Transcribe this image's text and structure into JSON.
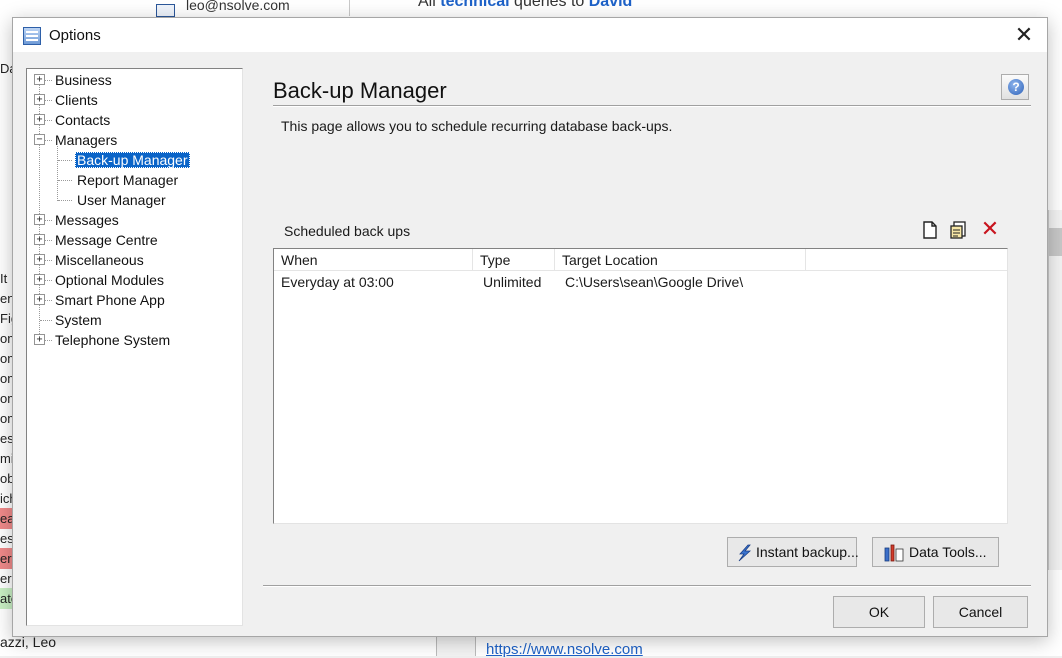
{
  "background": {
    "email": "leo@nsolve.com",
    "top_text_pre": "All ",
    "top_text_highlight1": "technical",
    "top_text_mid": " queries to ",
    "top_text_highlight2": "David",
    "left_fragments": [
      "Da",
      "It",
      "en",
      "Fig",
      "om",
      "om",
      "om",
      "om",
      "om",
      "est",
      "mit",
      "ob",
      "ich",
      "ea",
      "es",
      "erk",
      "erk",
      "ate"
    ],
    "bottom_name": "azzi, Leo",
    "url": "https://www.nsolve.com"
  },
  "dialog": {
    "title": "Options",
    "close_label": "✕"
  },
  "tree": {
    "items": [
      {
        "label": "Business",
        "level": 0,
        "expander": "+"
      },
      {
        "label": "Clients",
        "level": 0,
        "expander": "+"
      },
      {
        "label": "Contacts",
        "level": 0,
        "expander": "+"
      },
      {
        "label": "Managers",
        "level": 0,
        "expander": "−"
      },
      {
        "label": "Back-up Manager",
        "level": 1,
        "selected": true
      },
      {
        "label": "Report Manager",
        "level": 1
      },
      {
        "label": "User Manager",
        "level": 1
      },
      {
        "label": "Messages",
        "level": 0,
        "expander": "+"
      },
      {
        "label": "Message Centre",
        "level": 0,
        "expander": "+"
      },
      {
        "label": "Miscellaneous",
        "level": 0,
        "expander": "+"
      },
      {
        "label": "Optional Modules",
        "level": 0,
        "expander": "+"
      },
      {
        "label": "Smart Phone App",
        "level": 0,
        "expander": "+"
      },
      {
        "label": "System",
        "level": 0
      },
      {
        "label": "Telephone System",
        "level": 0,
        "expander": "+"
      }
    ]
  },
  "page": {
    "title": "Back-up Manager",
    "help_label": "?",
    "description": "This page allows you to schedule recurring database back-ups.",
    "scheduled_label": "Scheduled back ups",
    "delete_label": "✕"
  },
  "table": {
    "columns": [
      "When",
      "Type",
      "Target Location",
      ""
    ],
    "rows": [
      [
        "Everyday at 03:00",
        "Unlimited",
        "C:\\Users\\sean\\Google Drive\\"
      ]
    ]
  },
  "buttons": {
    "instant_backup": "Instant backup...",
    "data_tools": "Data Tools...",
    "ok": "OK",
    "cancel": "Cancel"
  },
  "colors": {
    "selection": "#0a64c8",
    "delete_red": "#c8141e",
    "link_blue": "#1e62c8"
  }
}
